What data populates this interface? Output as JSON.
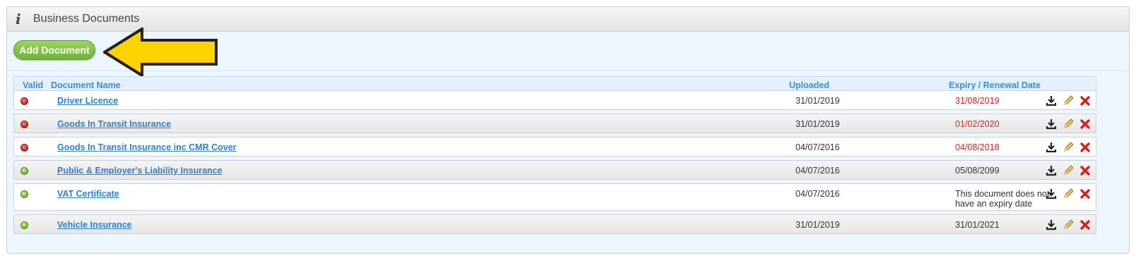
{
  "panel": {
    "title": "Business Documents",
    "icon": "info-icon"
  },
  "toolbar": {
    "add_label": "Add Document",
    "arrow_color": "#ffd200"
  },
  "table": {
    "headers": {
      "valid": "Valid",
      "name": "Document Name",
      "uploaded": "Uploaded",
      "expiry": "Expiry / Renewal Date"
    },
    "rows": [
      {
        "valid": false,
        "name": "Driver Licence",
        "uploaded": "31/01/2019",
        "expiry": "31/08/2019",
        "expired": true
      },
      {
        "valid": false,
        "name": "Goods In Transit Insurance",
        "uploaded": "31/01/2019",
        "expiry": "01/02/2020",
        "expired": true
      },
      {
        "valid": false,
        "name": "Goods In Transit Insurance inc CMR Cover",
        "uploaded": "04/07/2016",
        "expiry": "04/08/2018",
        "expired": true
      },
      {
        "valid": true,
        "name": "Public & Employer's Liability Insurance",
        "uploaded": "04/07/2016",
        "expiry": "05/08/2099",
        "expired": false
      },
      {
        "valid": true,
        "name": "VAT Certificate",
        "uploaded": "04/07/2016",
        "expiry": "This document does not have an expiry date",
        "expired": false
      },
      {
        "valid": true,
        "name": "Vehicle Insurance",
        "uploaded": "31/01/2019",
        "expiry": "31/01/2021",
        "expired": false
      }
    ],
    "actions": [
      "download-icon",
      "edit-pencil-icon",
      "delete-x-icon"
    ]
  },
  "colors": {
    "link": "#2b7fd0",
    "expired": "#e0201b",
    "valid": "#6db32e",
    "invalid": "#c0221f",
    "button": "#7fc246"
  }
}
